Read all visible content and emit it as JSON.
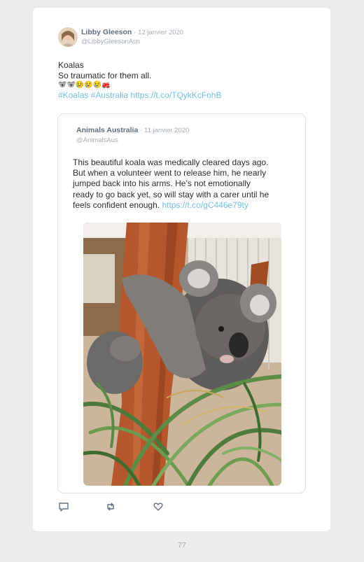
{
  "tweet": {
    "author_name": "Libby Gleeson",
    "date": "· 12 janvier 2020",
    "handle": "@LibbyGleesonAus",
    "line1": "Koalas",
    "line2": "So traumatic for them all.",
    "emojis": [
      "🐨",
      "🐨",
      "😢",
      "😢",
      "😢",
      "🚒"
    ],
    "hashtag1": "#Koalas",
    "hashtag2": "#Australia",
    "link": "https://t.co/TQykKcFohB"
  },
  "quoted_tweet": {
    "author_name": "Animals Australia",
    "date": "· 11 janvier 2020",
    "handle": "@AnimalsAus",
    "text_lines": [
      "This beautiful koala was medically cleared days ago.",
      "But when a volunteer went to release him, he nearly",
      "jumped back into his arms. He’s not emotionally",
      "ready to go back yet, so will stay with a carer until he",
      "feels confident enough."
    ],
    "link": "https://t.co/gC446e79ty",
    "photo_subject": "koala-climbing-tree-photo"
  },
  "actions": {
    "icons": [
      "reply-icon",
      "retweet-icon",
      "like-icon"
    ]
  },
  "page_number": "77",
  "colors": {
    "link": "#6fc0e8",
    "author": "#5e6f84",
    "meta": "#a4aeb8",
    "background": "#ebebeb"
  }
}
